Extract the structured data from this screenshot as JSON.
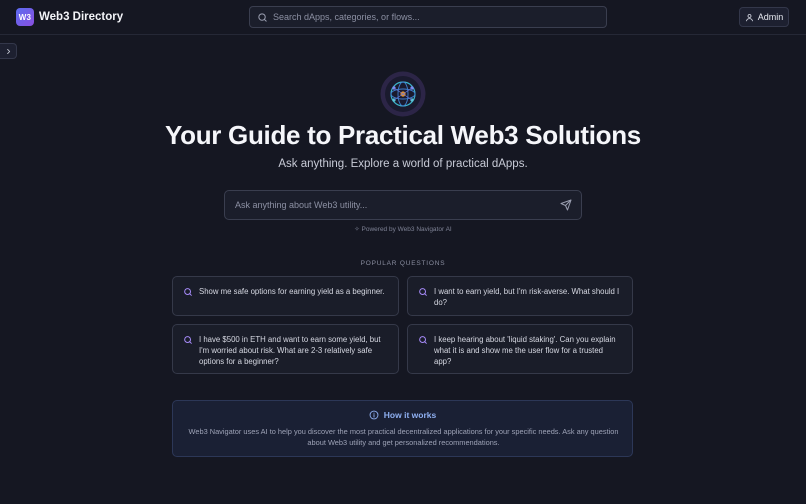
{
  "header": {
    "logo_text": "W3",
    "brand": "Web3 Directory",
    "search_placeholder": "Search dApps, categories, or flows...",
    "admin_label": "Admin"
  },
  "hero": {
    "title": "Your Guide to Practical Web3 Solutions",
    "subtitle": "Ask anything. Explore a world of practical dApps.",
    "ask_placeholder": "Ask anything about Web3 utility...",
    "powered_by": "Powered by Web3 Navigator AI"
  },
  "popular": {
    "heading": "POPULAR QUESTIONS",
    "questions": [
      "Show me safe options for earning yield as a beginner.",
      "I want to earn yield, but I'm risk-averse. What should I do?",
      "I have $500 in ETH and want to earn some yield, but I'm worried about risk. What are 2-3 relatively safe options for a beginner?",
      "I keep hearing about 'liquid staking'. Can you explain what it is and show me the user flow for a trusted app?"
    ]
  },
  "how_it_works": {
    "title": "How it works",
    "text": "Web3 Navigator uses AI to help you discover the most practical decentralized applications for your specific needs. Ask any question about Web3 utility and get personalized recommendations."
  },
  "icons": {
    "search": "search-icon",
    "user": "user-icon",
    "sidebar_toggle": "chevron-right-icon",
    "send": "send-icon",
    "info": "info-icon",
    "sparkle": "sparkle-icon",
    "hero": "network-globe-icon"
  },
  "colors": {
    "background": "#151722",
    "accent": "#8a4fe0",
    "info_accent": "#8fb0f2",
    "question_icon": "#a78bfa"
  }
}
